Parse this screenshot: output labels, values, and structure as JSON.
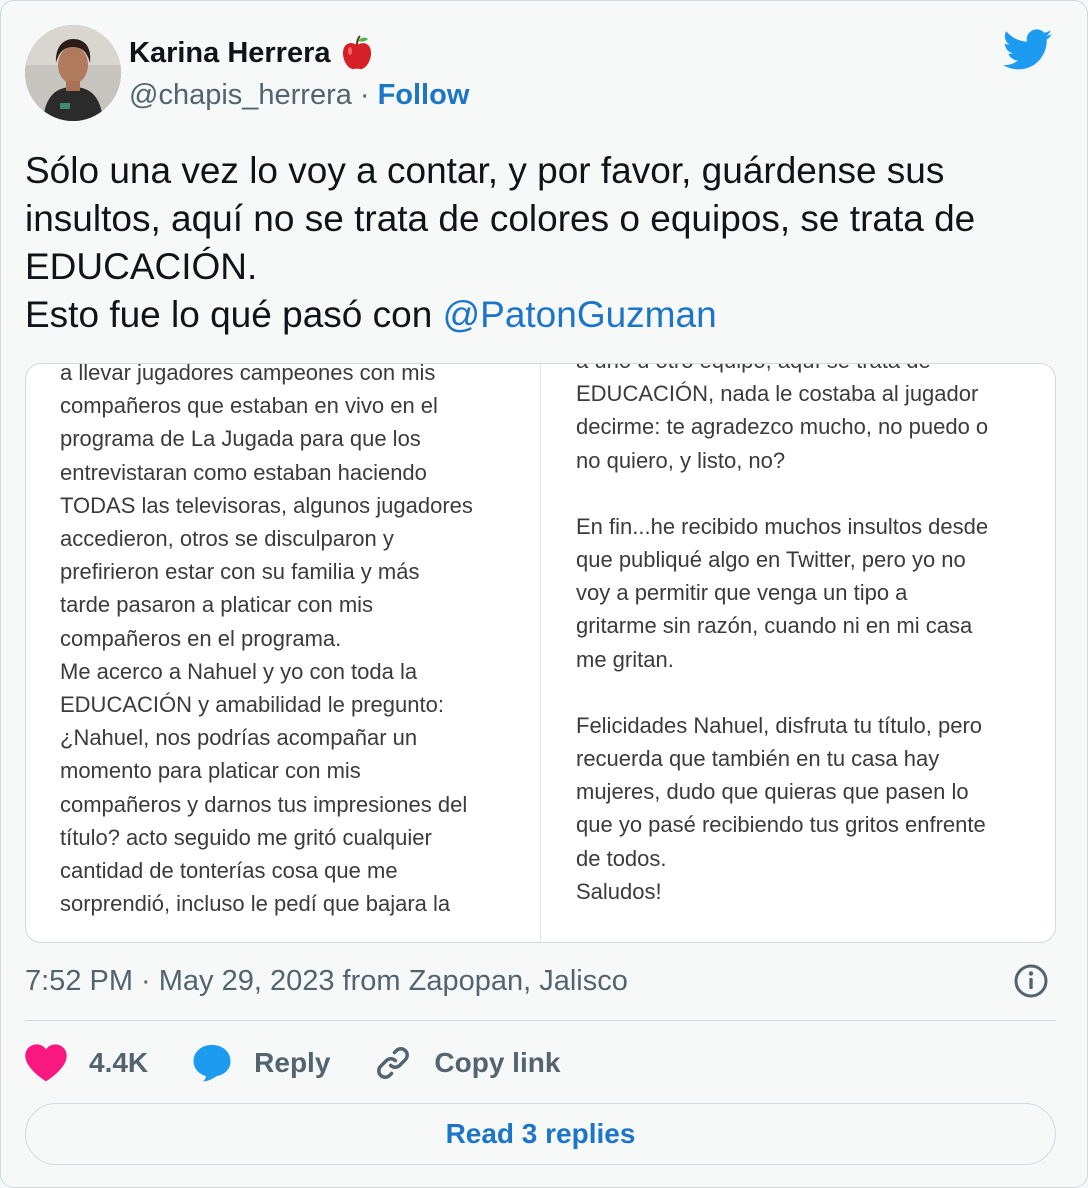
{
  "author": {
    "display_name": "Karina Herrera",
    "handle": "@chapis_herrera",
    "separator": "·",
    "follow_label": "Follow"
  },
  "tweet": {
    "text_lines": [
      "Sólo una vez lo voy a contar, y por favor, guárdense sus",
      "insultos, aquí no se trata de colores o equipos, se trata de",
      "EDUCACIÓN."
    ],
    "text_prefix": "Esto fue lo qué pasó con ",
    "mention": "@PatonGuzman"
  },
  "image_text": {
    "left_lines": [
      "a llevar jugadores campeones con mis",
      "compañeros que estaban en vivo en el",
      "programa de La Jugada para que los",
      "entrevistaran como estaban haciendo",
      "TODAS las televisoras, algunos jugadores",
      "accedieron, otros se disculparon y",
      "prefirieron estar con su familia y más",
      "tarde pasaron a platicar con mis",
      "compañeros en el programa.",
      "Me acerco a Nahuel y yo con toda la",
      "EDUCACIÓN y amabilidad le pregunto:",
      "¿Nahuel, nos podrías acompañar un",
      "momento para platicar con mis",
      "compañeros y darnos tus impresiones del",
      "título? acto seguido me gritó cualquier",
      "cantidad de tonterías cosa que me",
      "sorprendió, incluso le pedí que bajara la"
    ],
    "right_paragraphs": [
      [
        "a uno u otro equipo, aquí se trata de",
        "EDUCACIÓN, nada le costaba al jugador",
        "decirme: te agradezco mucho, no puedo o",
        "no quiero, y listo, no?"
      ],
      [
        "En fin...he recibido muchos insultos desde",
        "que publiqué algo en Twitter, pero yo no",
        "voy a permitir que venga un tipo a",
        "gritarme sin razón, cuando ni en mi casa",
        "me gritan."
      ],
      [
        "Felicidades Nahuel, disfruta tu título, pero",
        "recuerda que también en tu casa hay",
        "mujeres, dudo que quieras que pasen lo",
        "que yo pasé recibiendo tus gritos enfrente",
        "de todos.",
        "Saludos!"
      ]
    ]
  },
  "meta": {
    "timestamp": "7:52 PM · May 29, 2023 from Zapopan, Jalisco"
  },
  "actions": {
    "likes": "4.4K",
    "reply_label": "Reply",
    "copy_link_label": "Copy link",
    "read_replies_label": "Read 3 replies"
  },
  "colors": {
    "link_blue": "#1d75c8",
    "twitter_blue": "#1d9bf0",
    "like_pink": "#f91880",
    "muted_text": "#536471"
  },
  "icons": [
    "apple-icon",
    "twitter-bird-icon",
    "info-icon",
    "heart-icon",
    "reply-bubble-icon",
    "link-icon"
  ]
}
